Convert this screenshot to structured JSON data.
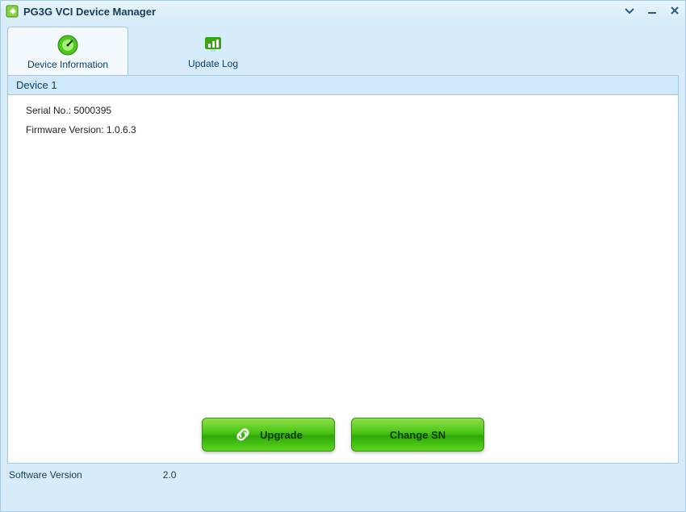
{
  "window": {
    "title": "PG3G VCI Device Manager"
  },
  "tabs": {
    "device_info": {
      "label": "Device Information"
    },
    "update_log": {
      "label": "Update Log"
    }
  },
  "panel": {
    "header": "Device 1",
    "serial_label": "Serial No.: ",
    "serial_value": "5000395",
    "firmware_label": "Firmware Version: ",
    "firmware_value": "1.0.6.3"
  },
  "actions": {
    "upgrade": "Upgrade",
    "change_sn": "Change SN"
  },
  "statusbar": {
    "label": "Software Version",
    "value": "2.0"
  }
}
